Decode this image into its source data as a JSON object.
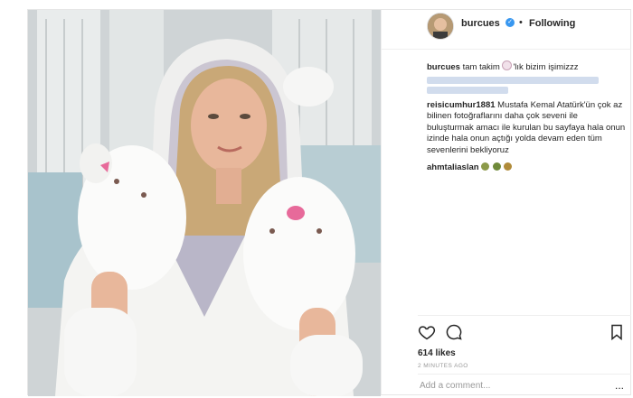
{
  "header": {
    "username": "burcues",
    "separator": "•",
    "follow_status": "Following"
  },
  "caption": {
    "username": "burcues",
    "text_before_emoji": "tam takim",
    "text_after_emoji": "'lık bizim işimizzz"
  },
  "comments": [
    {
      "username": "reisicumhur1881",
      "text": "Mustafa Kemal Atatürk'ün çok az bilinen fotoğraflarını daha çok seveni ile buluşturmak amacı ile kurulan bu sayfaya hala onun izinde hala onun açtığı yolda devam eden tüm sevenlerini bekliyoruz"
    },
    {
      "username": "ahmtaliaslan",
      "emoji_names": [
        "emoji-face-1",
        "emoji-face-2",
        "emoji-face-3"
      ]
    }
  ],
  "post": {
    "likes": "614 likes",
    "time": "2 MINUTES AGO",
    "comment_placeholder": "Add a comment...",
    "more": "..."
  },
  "colors": {
    "verified": "#3897f0",
    "blur": "#c9d6ea"
  }
}
